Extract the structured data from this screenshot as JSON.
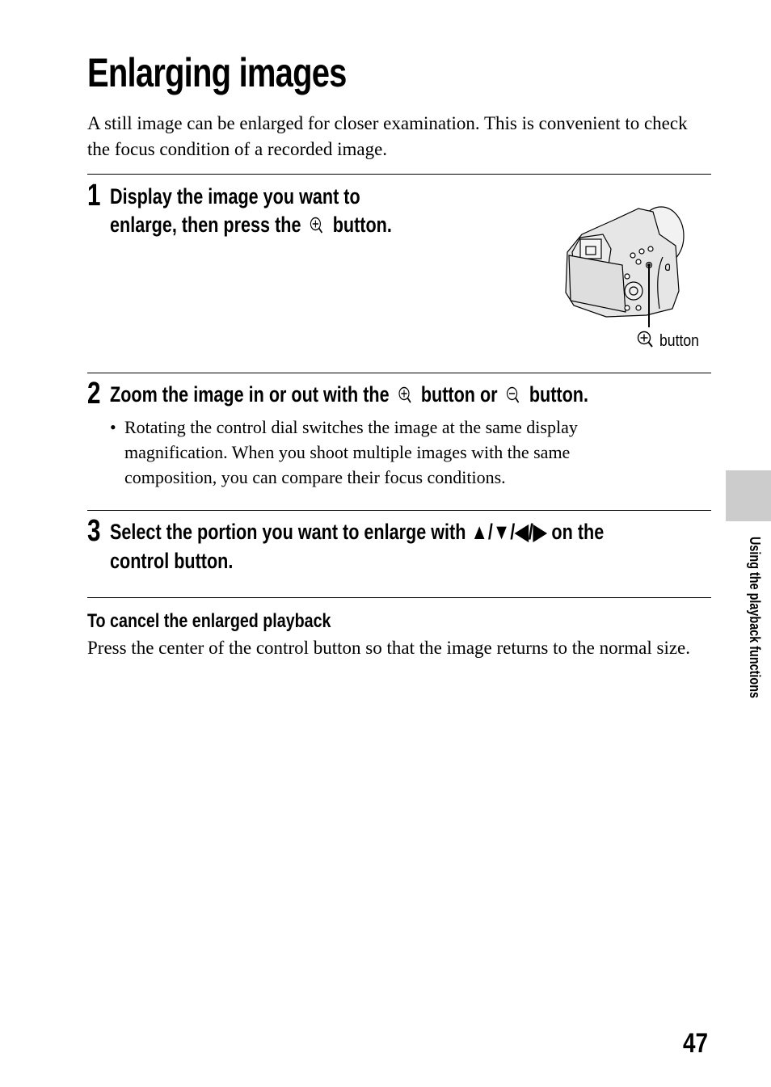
{
  "page": {
    "title": "Enlarging images",
    "intro": "A still image can be enlarged for closer examination. This is convenient to check the focus condition of a recorded image.",
    "steps": [
      {
        "number": "1",
        "line1": "Display the image you want to",
        "line2_before_icon": "enlarge, then press the",
        "line2_icon": "zoom-in-icon",
        "line2_after_icon": "button."
      },
      {
        "number": "2",
        "text_part1": "Zoom the image in or out with the",
        "icon1": "zoom-in-icon",
        "text_part2": "button or",
        "icon2": "zoom-out-icon",
        "text_part3": "button.",
        "bullets": [
          "Rotating the control dial switches the image at the same display magnification. When you shoot multiple images with the same composition, you can compare their focus conditions."
        ]
      },
      {
        "number": "3",
        "line1": "Select the portion you want to enlarge with ▲/▼/◀/▶ on the",
        "line2": "control button."
      }
    ],
    "figure": {
      "icon": "zoom-in-icon",
      "caption": "button"
    },
    "cancel_section": {
      "heading": "To cancel the enlarged playback",
      "text": "Press the center of the control button so that the image returns to the normal size."
    },
    "side_tab": {
      "label": "Using the playback functions",
      "color": "#cccccc"
    },
    "page_number": "47",
    "bullet_char": "•"
  }
}
